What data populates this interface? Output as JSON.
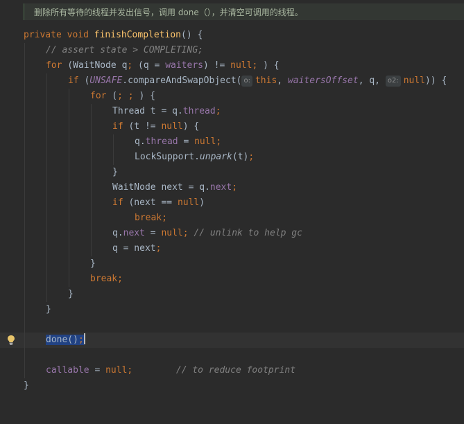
{
  "doc_comment": "删除所有等待的线程并发出信号，调用 done（），并清空可调用的线程。",
  "code": {
    "l1": [
      "private",
      " ",
      "void",
      " ",
      "finishCompletion",
      "() {"
    ],
    "l2": "// assert state > COMPLETING;",
    "l3": [
      "for",
      " (WaitNode q",
      ";",
      " (q = ",
      "waiters",
      ") != ",
      "null",
      ";",
      " ) {"
    ],
    "l4": [
      "if",
      " (",
      "UNSAFE",
      ".compareAndSwapObject(",
      "o:",
      "this",
      ", ",
      "waitersOffset",
      ", q, ",
      "o2:",
      "null",
      ")) {"
    ],
    "l5": [
      "for",
      " (",
      ";",
      " ",
      ";",
      " ) {"
    ],
    "l6": [
      "Thread t = q.",
      "thread",
      ";"
    ],
    "l7": [
      "if",
      " (t != ",
      "null",
      ") {"
    ],
    "l8": [
      "q.",
      "thread",
      " = ",
      "null",
      ";"
    ],
    "l9": [
      "LockSupport.",
      "unpark",
      "(t)",
      ";"
    ],
    "l10": "}",
    "l11": [
      "WaitNode next = q.",
      "next",
      ";"
    ],
    "l12": [
      "if",
      " (next == ",
      "null",
      ")"
    ],
    "l13": [
      "break",
      ";"
    ],
    "l14": [
      "q.",
      "next",
      " = ",
      "null",
      ";",
      " // unlink to help gc"
    ],
    "l15": [
      "q = next",
      ";"
    ],
    "l16": "}",
    "l17": [
      "break",
      ";"
    ],
    "l18": "}",
    "l19": "}",
    "l20": [
      "done()",
      ";"
    ],
    "l21": [
      "callable",
      " = ",
      "null",
      ";",
      "        // to reduce footprint"
    ],
    "l22": "}"
  },
  "icons": {
    "intention": "lightbulb-icon"
  },
  "colors": {
    "background": "#2b2b2b",
    "keyword": "#cc7832",
    "method": "#ffc66d",
    "field": "#9876aa",
    "comment": "#808080",
    "text": "#a9b7c6",
    "selection": "#214283"
  }
}
